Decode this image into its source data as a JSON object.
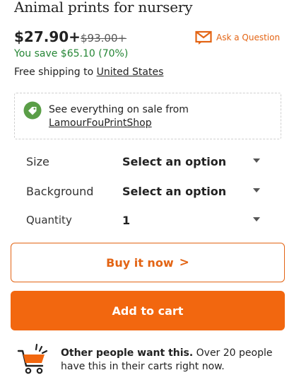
{
  "listing": {
    "title": "Animal prints for nursery",
    "price": "$27.90+",
    "original_price": "$93.00+",
    "savings": "You save $65.10 (70%)",
    "shipping_prefix": "Free shipping to ",
    "shipping_destination": "United States"
  },
  "ask_question": {
    "label": "Ask a Question"
  },
  "sale": {
    "line1": "See everything on sale from",
    "shop_name": "LamourFouPrintShop"
  },
  "options": [
    {
      "label": "Size",
      "value": "Select an option"
    },
    {
      "label": "Background",
      "value": "Select an option"
    },
    {
      "label": "Quantity",
      "value": "1"
    }
  ],
  "buttons": {
    "buy_now": "Buy it now",
    "buy_now_chevron": ">",
    "add_to_cart": "Add to cart"
  },
  "demand": {
    "bold": "Other people want this.",
    "text": " Over 20 people have this in their carts right now."
  },
  "colors": {
    "accent": "#e36414",
    "cart_button": "#f2670f",
    "savings_green": "#258635",
    "sale_tag_green": "#5a9e47"
  }
}
